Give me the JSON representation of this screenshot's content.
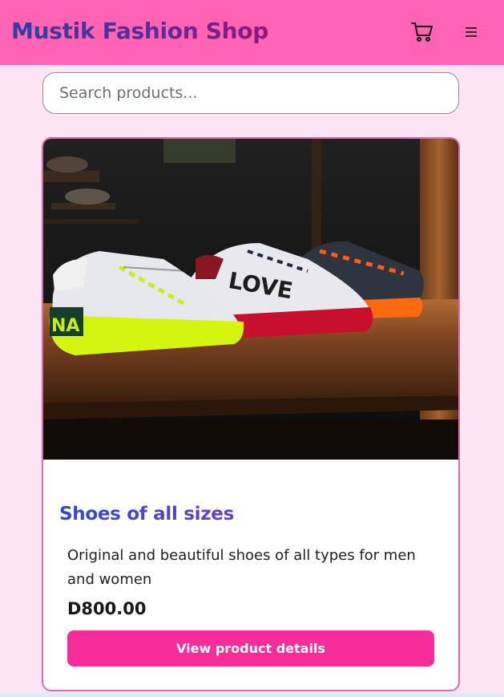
{
  "header": {
    "brand": "Mustik Fashion Shop",
    "cart_icon": "cart-icon",
    "menu_icon": "hamburger-menu-icon",
    "background": "#ff63b1"
  },
  "search": {
    "placeholder": "Search products...",
    "value": ""
  },
  "product": {
    "image_alt": "Row of sneakers on a wooden shelf",
    "title": "Shoes of all sizes",
    "description": "Original and beautiful shoes of all types for men and women",
    "price": "D800.00",
    "button_label": "View product details",
    "accent": "#f72d9a"
  }
}
